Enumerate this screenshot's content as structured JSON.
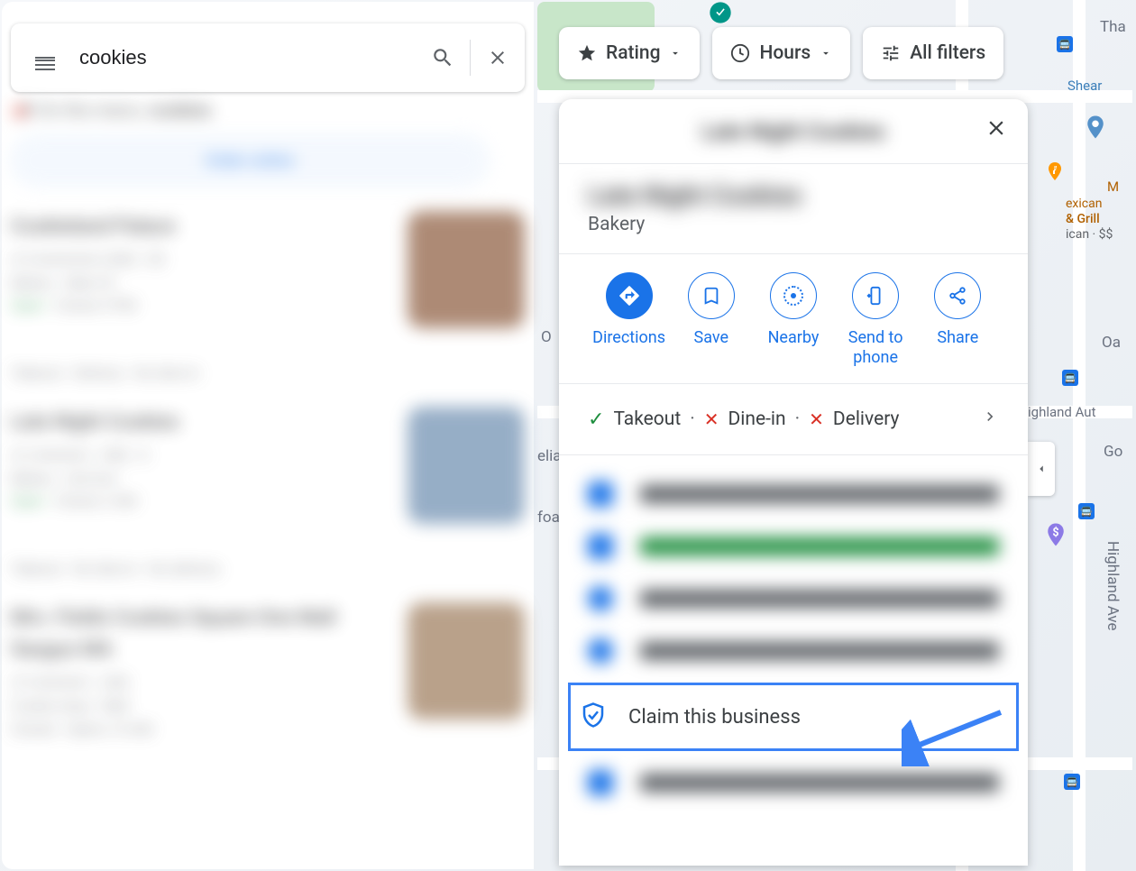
{
  "search": {
    "query": "cookies"
  },
  "menu_line": {
    "prefix": "On the menu:",
    "query": "cookies"
  },
  "order_label": "Order online",
  "chips": {
    "rating": "Rating",
    "hours": "Hours",
    "all_filters": "All filters"
  },
  "detail": {
    "header_title": "Late Night Cookies",
    "biz_name": "Late Night Cookies",
    "category": "Bakery",
    "actions": {
      "directions": "Directions",
      "save": "Save",
      "nearby": "Nearby",
      "send": "Send to phone",
      "share": "Share"
    },
    "services": {
      "takeout": "Takeout",
      "dinein": "Dine-in",
      "delivery": "Delivery"
    },
    "claim": "Claim this business"
  },
  "map": {
    "street_highland": "Highland Ave",
    "street_oa": "Oa",
    "street_tha": "Tha",
    "street_eliab": "eliab",
    "street_foa": "foa",
    "street_go": "Go",
    "street_o": "O",
    "poi_grill_line1": "exican",
    "poi_grill_line2": "& Grill",
    "poi_grill_line3": "ican · $$",
    "poi_highland_auto": "ighland Aut",
    "poi_shear": "Shear",
    "poi_m": "M"
  }
}
